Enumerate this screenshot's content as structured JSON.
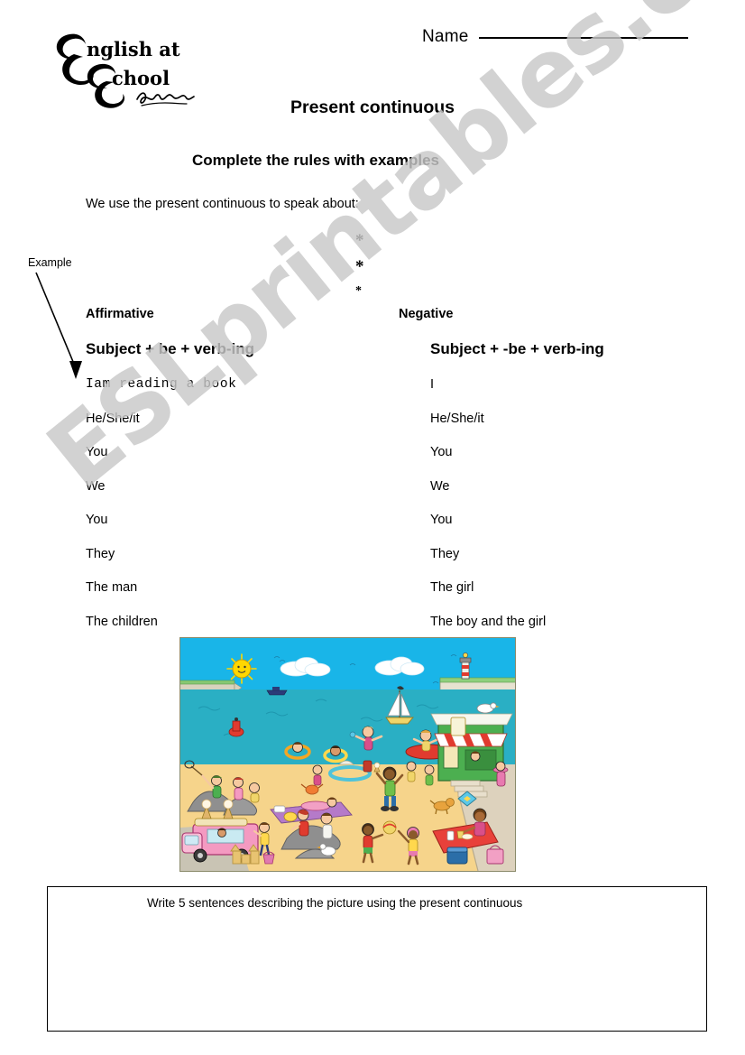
{
  "header": {
    "logo_line1": "English at",
    "logo_line2": "School",
    "logo_signature": "Paula Hoecker",
    "name_label": "Name",
    "name_value": ""
  },
  "title": "Present continuous",
  "subtitle": "Complete the rules with examples",
  "intro": "We use the present continuous to speak about:",
  "bullets": [
    "*",
    "*",
    "*"
  ],
  "example_annotation": {
    "label": "Example",
    "arrow": "diagonal-arrow-down-right"
  },
  "columns": [
    {
      "heading": "Affirmative",
      "formula": "Subject + be + verb-ing",
      "rows": [
        "Iam reading a book",
        "He/She/it",
        "You",
        "We",
        "You",
        "They",
        "The man",
        "The children"
      ]
    },
    {
      "heading": "Negative",
      "formula_prefix": "Subject + ",
      "formula_emphasis": "-be",
      "formula_suffix": " + verb-ing",
      "formula": "Subject + -be + verb-ing",
      "rows": [
        "I",
        "He/She/it",
        "You",
        "We",
        "You",
        "They",
        "The girl",
        "The boy and the girl"
      ]
    }
  ],
  "illustration": {
    "alt": "beach-scene-with-children-playing",
    "colors": {
      "sky": "#19b5e8",
      "sea": "#2aafc4",
      "sand": "#f6d48b",
      "promenade": "#d9cfc0",
      "shop_green": "#4caf50",
      "awning_red": "#e03b2f",
      "truck_pink": "#f49ac1",
      "blanket_red": "#e8413a",
      "rock_gray": "#8f8f8f",
      "sun_yellow": "#ffd700"
    }
  },
  "answer_box": {
    "prompt": "Write 5 sentences describing the picture using the present continuous",
    "lines": []
  },
  "watermark": "ESLprintables.com"
}
